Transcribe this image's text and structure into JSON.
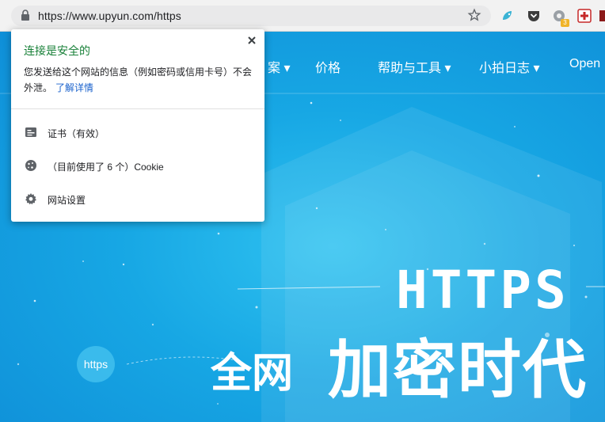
{
  "browser": {
    "url": "https://www.upyun.com/https",
    "extension_badge": "3"
  },
  "nav": {
    "items": [
      "案 ▾",
      "价格",
      "帮助与工具 ▾",
      "小拍日志 ▾",
      "Open"
    ]
  },
  "hero": {
    "title_en": "HTTPS",
    "title_cn_small": "全网",
    "title_cn_large": "加密时代",
    "bubble": "https"
  },
  "popup": {
    "title": "连接是安全的",
    "description": "您发送给这个网站的信息（例如密码或信用卡号）不会外泄。",
    "link": "了解详情",
    "rows": [
      {
        "label": "证书（有效）",
        "icon": "certificate-icon"
      },
      {
        "label": "（目前使用了 6 个）Cookie",
        "icon": "cookie-icon"
      },
      {
        "label": "网站设置",
        "icon": "gear-icon"
      }
    ]
  },
  "colors": {
    "secure_green": "#188038",
    "link_blue": "#1a62cc",
    "hero_blue": "#1ba6e3"
  }
}
